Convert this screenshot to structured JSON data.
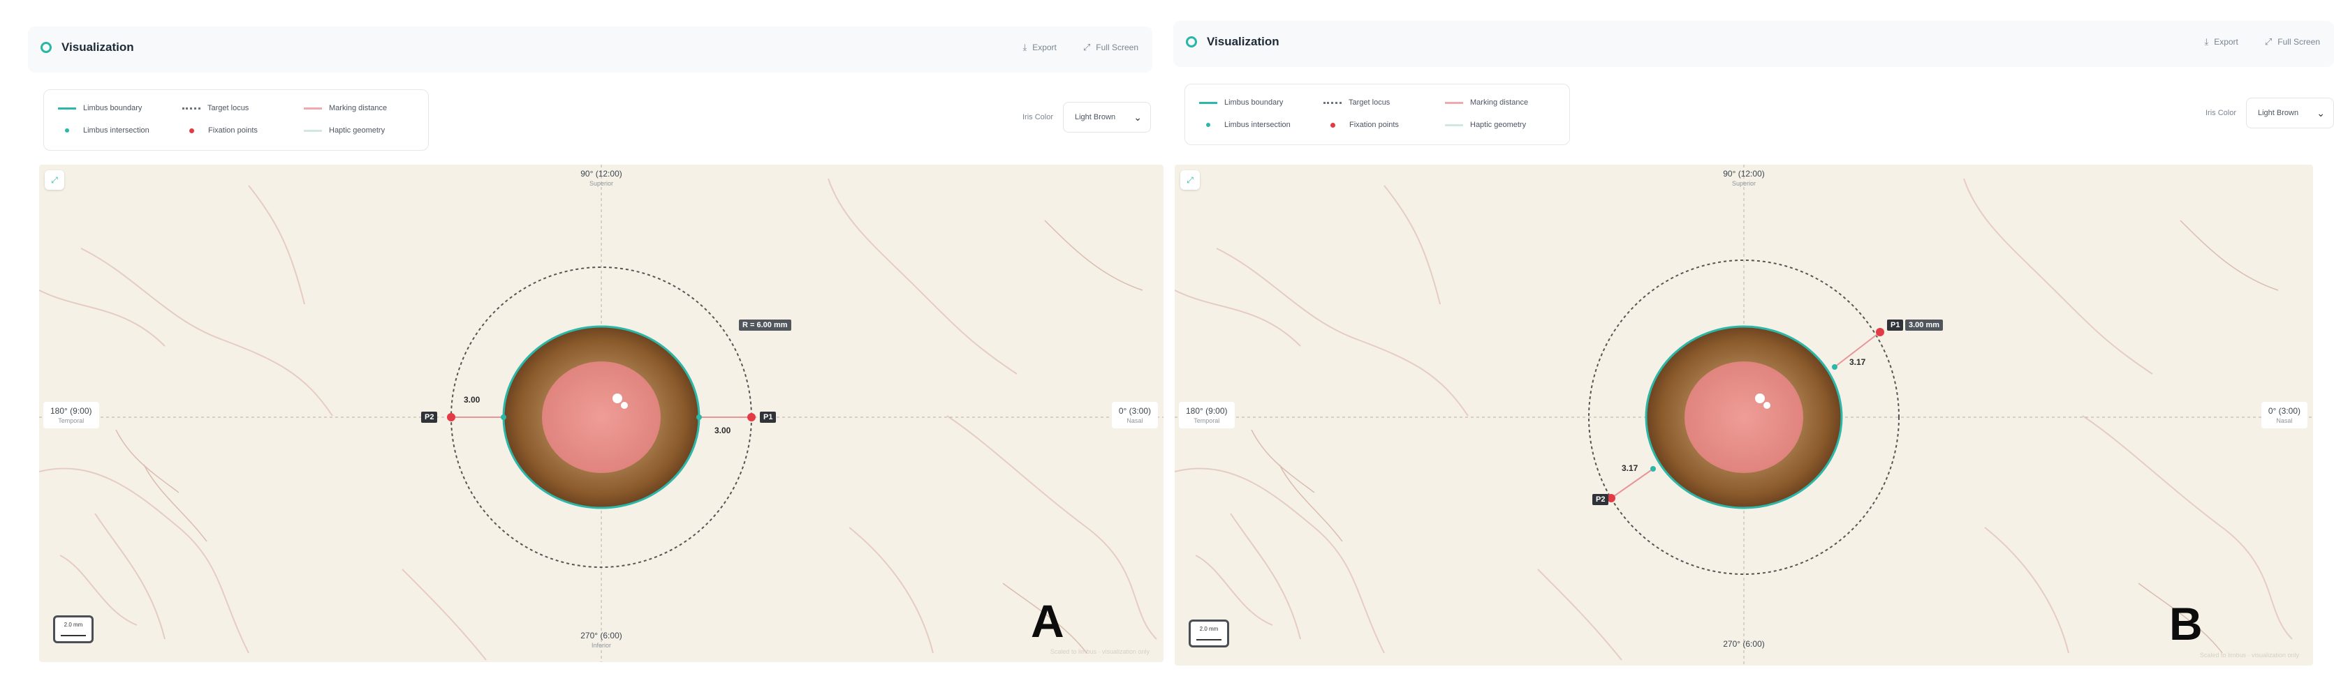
{
  "panels": [
    {
      "id": "A",
      "header": {
        "title": "Visualization",
        "export_label": "Export",
        "fullscreen_label": "Full Screen"
      },
      "legend": {
        "limbus_boundary": "Limbus boundary",
        "target_locus": "Target locus",
        "marking_distance": "Marking distance",
        "limbus_intersection": "Limbus intersection",
        "fixation_points": "Fixation points",
        "haptic_geometry": "Haptic geometry"
      },
      "iris_color": {
        "label": "Iris Color",
        "value": "Light Brown"
      },
      "axes": {
        "top": "90° (12:00)",
        "top_sub": "Superior",
        "left": "180° (9:00)",
        "left_sub": "Temporal",
        "right": "0° (3:00)",
        "right_sub": "Nasal",
        "bottom": "270° (6:00)",
        "bottom_sub": "Inferior"
      },
      "radius_tag": "R = 6.00 mm",
      "p1": "P1",
      "p2": "P2",
      "dist_left": "3.00",
      "dist_right": "3.00",
      "scale": "2.0 mm",
      "panel_letter": "A",
      "watermark": "Scaled to limbus · visualization only"
    },
    {
      "id": "B",
      "header": {
        "title": "Visualization",
        "export_label": "Export",
        "fullscreen_label": "Full Screen"
      },
      "legend": {
        "limbus_boundary": "Limbus boundary",
        "target_locus": "Target locus",
        "marking_distance": "Marking distance",
        "limbus_intersection": "Limbus intersection",
        "fixation_points": "Fixation points",
        "haptic_geometry": "Haptic geometry"
      },
      "iris_color": {
        "label": "Iris Color",
        "value": "Light Brown"
      },
      "axes": {
        "top": "90° (12:00)",
        "top_sub": "Superior",
        "left": "180° (9:00)",
        "left_sub": "Temporal",
        "right": "0° (3:00)",
        "right_sub": "Nasal",
        "bottom": "270° (6:00)",
        "bottom_sub": ""
      },
      "p1": "P1",
      "p1_distance": "3.00 mm",
      "p2": "P2",
      "dist_upper": "3.17",
      "dist_lower": "3.17",
      "scale": "2.0 mm",
      "panel_letter": "B",
      "watermark": "Scaled to limbus · visualization only"
    }
  ],
  "colors": {
    "accent": "#2cb7a9",
    "iris_outer": "#8a5a2b",
    "pupil": "#e8958f",
    "fixation": "#e23b45",
    "background": "#f6f1e6"
  },
  "icons": [
    "circle-icon",
    "export-icon",
    "fullscreen-icon",
    "chevron-down-icon",
    "expand-icon"
  ]
}
